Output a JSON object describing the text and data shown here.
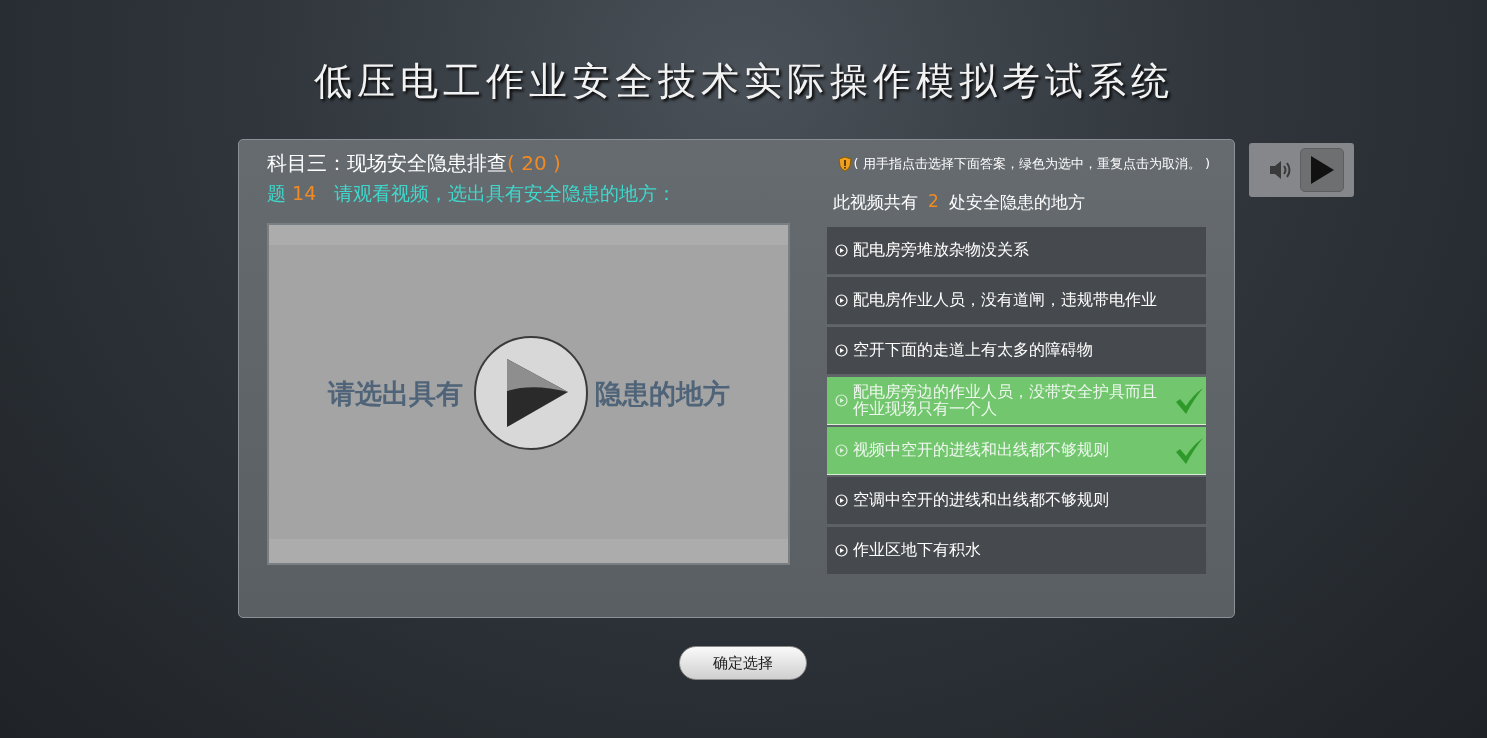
{
  "title": "低压电工作业安全技术实际操作模拟考试系统",
  "subject": {
    "label": "科目三：现场安全隐患排查",
    "score": "( 20 )"
  },
  "hint": "( 用手指点击选择下面答案，绿色为选中，重复点击为取消。 )",
  "question": {
    "prefix": "题",
    "number": "14",
    "text": "请观看视频，选出具有安全隐患的地方："
  },
  "count": {
    "before": "此视频共有",
    "number": "2",
    "after": "处安全隐患的地方"
  },
  "video": {
    "caption_left": "请选出具有",
    "caption_right": "隐患的地方"
  },
  "options": [
    {
      "text": "配电房旁堆放杂物没关系",
      "selected": false
    },
    {
      "text": "配电房作业人员，没有道闸，违规带电作业",
      "selected": false
    },
    {
      "text": "空开下面的走道上有太多的障碍物",
      "selected": false
    },
    {
      "text": "配电房旁边的作业人员，没带安全护具而且作业现场只有一个人",
      "selected": true
    },
    {
      "text": "视频中空开的进线和出线都不够规则",
      "selected": true
    },
    {
      "text": "空调中空开的进线和出线都不够规则",
      "selected": false
    },
    {
      "text": "作业区地下有积水",
      "selected": false
    }
  ],
  "confirm_button": "确定选择"
}
